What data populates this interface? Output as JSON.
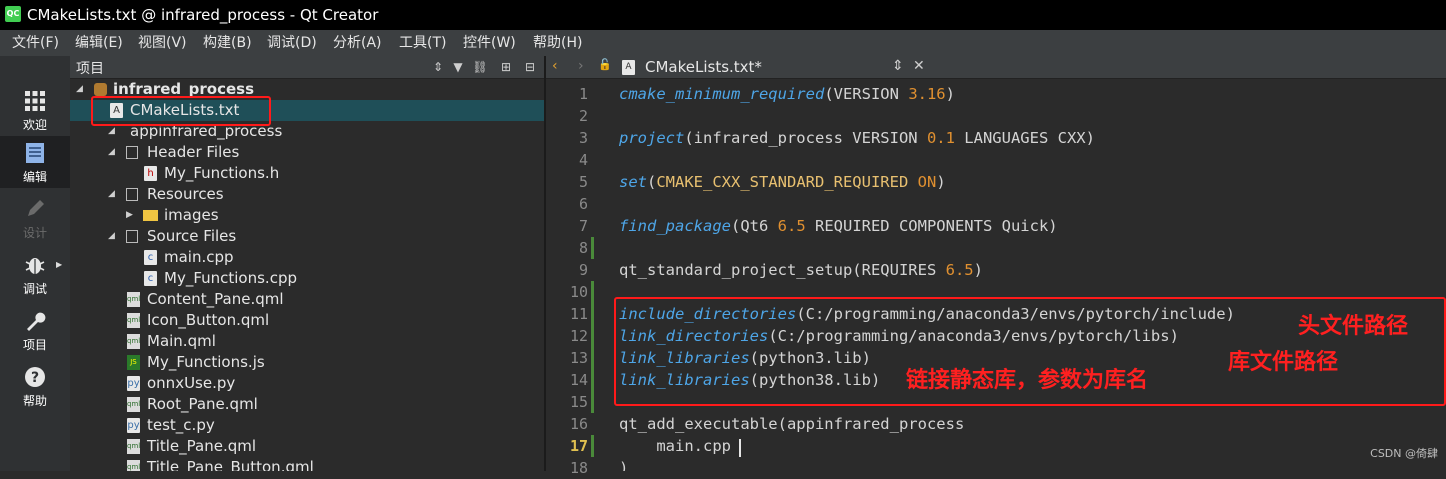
{
  "window": {
    "title": "CMakeLists.txt @ infrared_process - Qt Creator",
    "app_icon": "QC"
  },
  "menu": [
    "文件(F)",
    "编辑(E)",
    "视图(V)",
    "构建(B)",
    "调试(D)",
    "分析(A)",
    "工具(T)",
    "控件(W)",
    "帮助(H)"
  ],
  "modes": [
    {
      "label": "欢迎",
      "icon": "grid-icon"
    },
    {
      "label": "编辑",
      "icon": "edit-doc-icon"
    },
    {
      "label": "设计",
      "icon": "pencil-icon"
    },
    {
      "label": "调试",
      "icon": "bug-icon"
    },
    {
      "label": "项目",
      "icon": "wrench-icon"
    },
    {
      "label": "帮助",
      "icon": "help-icon"
    }
  ],
  "projects": {
    "header_label": "项目",
    "tree": [
      "infrared_process",
      "CMakeLists.txt",
      "appinfrared_process",
      "Header Files",
      "My_Functions.h",
      "Resources",
      "images",
      "Source Files",
      "main.cpp",
      "My_Functions.cpp",
      "Content_Pane.qml",
      "Icon_Button.qml",
      "Main.qml",
      "My_Functions.js",
      "onnxUse.py",
      "Root_Pane.qml",
      "test_c.py",
      "Title_Pane.qml",
      "Title_Pane_Button.qml"
    ]
  },
  "editor": {
    "tab_name": "CMakeLists.txt*",
    "current_line": "17",
    "line_numbers": [
      "1",
      "2",
      "3",
      "4",
      "5",
      "6",
      "7",
      "8",
      "9",
      "10",
      "11",
      "12",
      "13",
      "14",
      "15",
      "16",
      "17",
      "18"
    ],
    "lines": {
      "l1": {
        "fn": "cmake_minimum_required",
        "a": "(VERSION ",
        "n": "3.16",
        "b": ")"
      },
      "l3": {
        "fn": "project",
        "a": "(infrared_process VERSION ",
        "n": "0.1",
        "b": " LANGUAGES CXX)"
      },
      "l5": {
        "fn": "set",
        "a": "(",
        "v": "CMAKE_CXX_STANDARD_REQUIRED",
        "sp": " ",
        "k": "ON",
        "b": ")"
      },
      "l7": {
        "fn": "find_package",
        "a": "(Qt6 ",
        "n": "6.5",
        "b": " REQUIRED COMPONENTS Quick)"
      },
      "l9": {
        "a": "qt_standard_project_setup(REQUIRES ",
        "n": "6.5",
        "b": ")"
      },
      "l11": {
        "fn": "include_directories",
        "a": "(C:/programming/anaconda3/envs/pytorch/include)"
      },
      "l12": {
        "fn": "link_directories",
        "a": "(C:/programming/anaconda3/envs/pytorch/libs)"
      },
      "l13": {
        "fn": "link_libraries",
        "a": "(python3.lib)"
      },
      "l14": {
        "fn": "link_libraries",
        "a": "(python38.lib)"
      },
      "l16": {
        "a": "qt_add_executable(appinfrared_process"
      },
      "l17": {
        "a": "    main.cpp"
      },
      "l18": {
        "a": ")"
      }
    }
  },
  "annotations": {
    "header_path": "头文件路径",
    "lib_path": "库文件路径",
    "link_note": "链接静态库，参数为库名"
  },
  "watermark": "CSDN @倚肆",
  "colors": {
    "annotation_red": "#ff1a1a",
    "selection": "#1f4f58",
    "function": "#4ea6e8",
    "number": "#e09030"
  }
}
